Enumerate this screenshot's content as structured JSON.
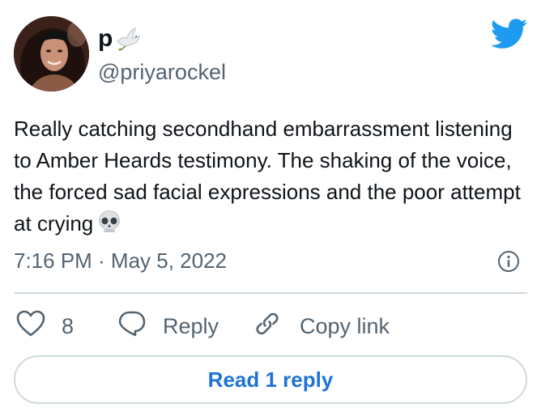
{
  "author": {
    "display_name": "p",
    "display_name_emoji": "dove-icon",
    "handle": "@priyarockel",
    "avatar": "avatar"
  },
  "brand": {
    "icon": "twitter-bird-icon",
    "color": "#1d9bf0"
  },
  "tweet": {
    "text": "Really catching secondhand embarrassment listening to Amber Heards testimony. The shaking of the voice, the forced sad facial expressions and the poor attempt at crying",
    "trailing_emoji": "skull-icon",
    "timestamp": "7:16 PM · May 5, 2022"
  },
  "actions": {
    "like_count": "8",
    "reply_label": "Reply",
    "copy_link_label": "Copy link"
  },
  "read_replies_label": "Read 1 reply",
  "colors": {
    "text": "#0f1419",
    "secondary": "#536471",
    "link": "#1d73d6",
    "border": "#cfd9de"
  }
}
